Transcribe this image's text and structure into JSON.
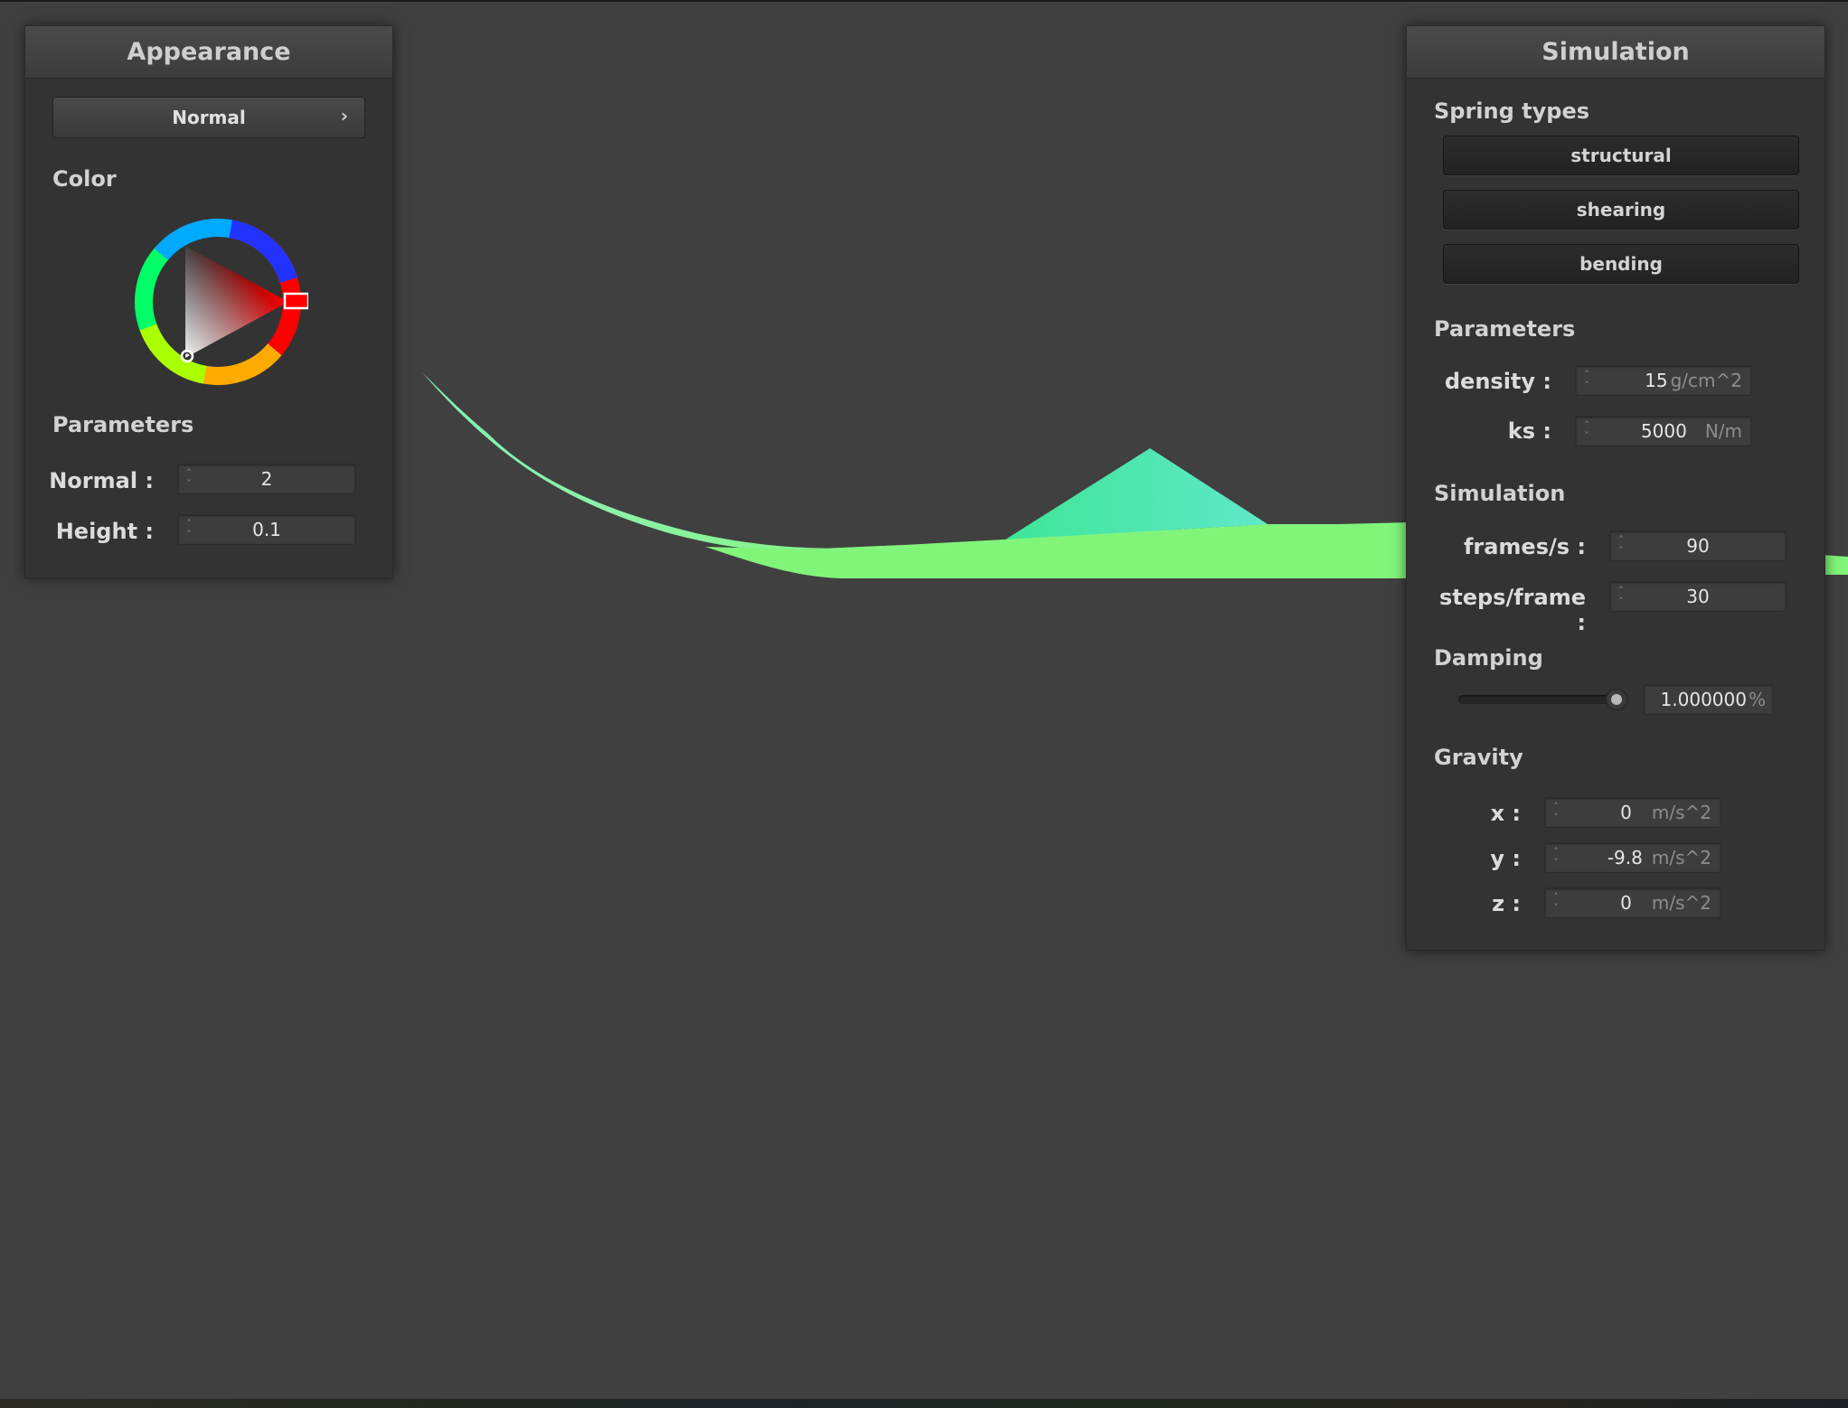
{
  "appearance": {
    "title": "Appearance",
    "shader_select": "Normal",
    "color_label": "Color",
    "selected_color": "#ff0000",
    "parameters_label": "Parameters",
    "normal": {
      "label": "Normal :",
      "value": "2"
    },
    "height": {
      "label": "Height :",
      "value": "0.1"
    }
  },
  "simulation": {
    "title": "Simulation",
    "spring_types_label": "Spring types",
    "springs": {
      "structural": "structural",
      "shearing": "shearing",
      "bending": "bending"
    },
    "parameters_label": "Parameters",
    "density": {
      "label": "density :",
      "value": "15",
      "unit": "g/cm^2"
    },
    "ks": {
      "label": "ks :",
      "value": "5000",
      "unit": "N/m"
    },
    "sim_label": "Simulation",
    "frames": {
      "label": "frames/s :",
      "value": "90"
    },
    "steps": {
      "label": "steps/frame :",
      "value": "30"
    },
    "damping_label": "Damping",
    "damping": {
      "value": "1.000000",
      "unit": "%",
      "level": 1.0
    },
    "gravity_label": "Gravity",
    "gx": {
      "label": "x :",
      "value": "0",
      "unit": "m/s^2"
    },
    "gy": {
      "label": "y :",
      "value": "-9.8",
      "unit": "m/s^2"
    },
    "gz": {
      "label": "z :",
      "value": "0",
      "unit": "m/s^2"
    }
  },
  "icons": {
    "spin": "spin-arrows-icon",
    "chevron": "chevron-right-icon",
    "color_wheel": "color-wheel-icon"
  },
  "colors": {
    "background": "#404040",
    "panel": "#333333",
    "cloth": "#7cf57a"
  }
}
